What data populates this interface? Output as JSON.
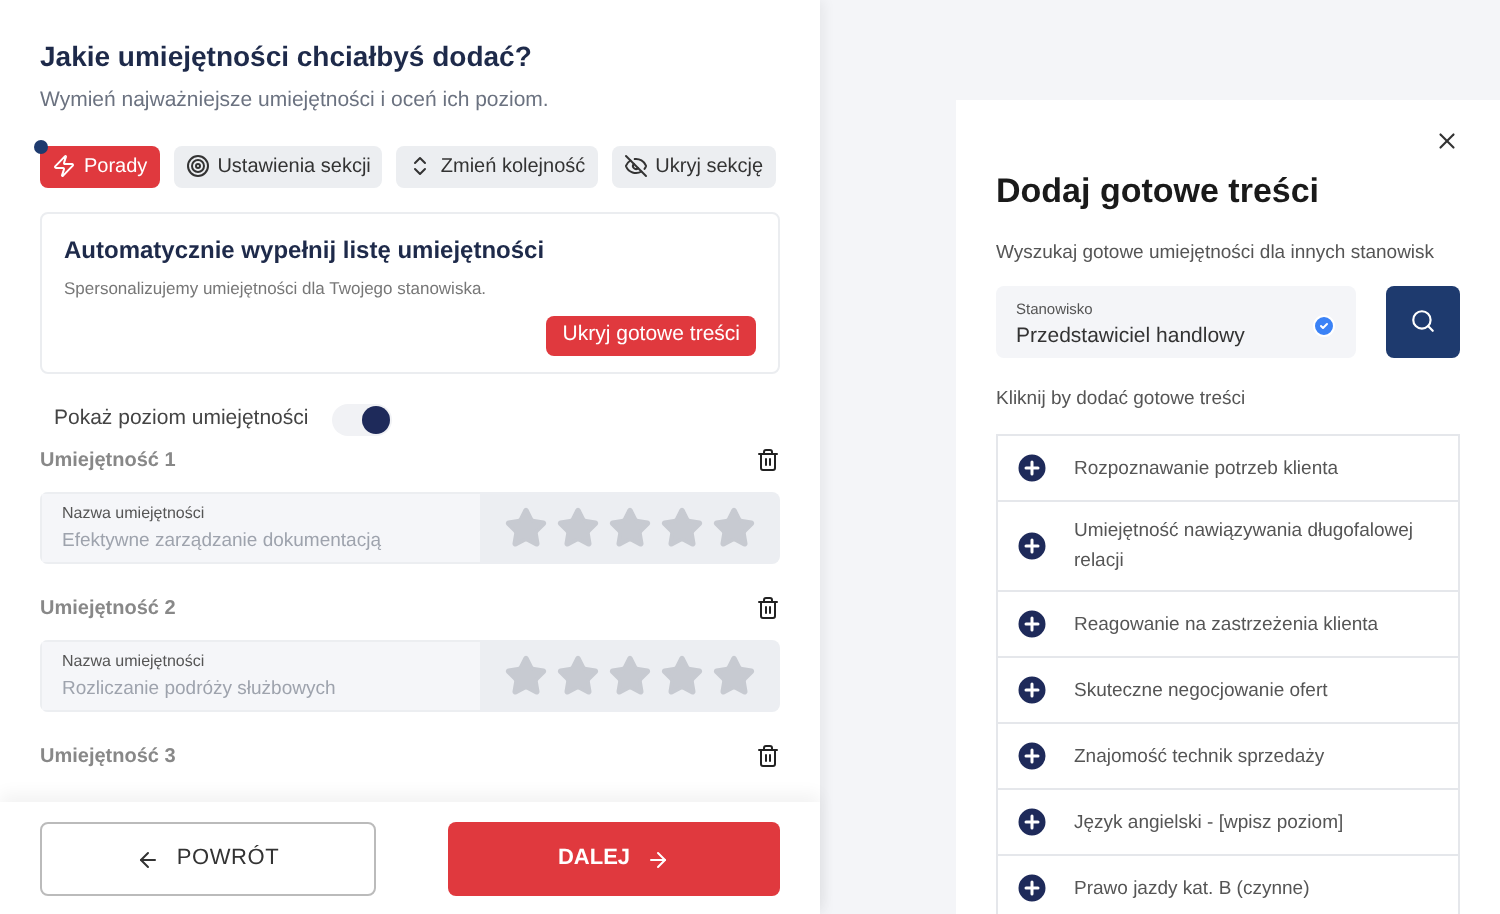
{
  "header": {
    "title": "Jakie umiejętności chciałbyś dodać?",
    "subtitle": "Wymień najważniejsze umiejętności i oceń ich poziom."
  },
  "toolbar": [
    {
      "kind": "tips",
      "label": "Porady",
      "selected": true
    },
    {
      "kind": "settings",
      "label": "Ustawienia sekcji",
      "selected": false
    },
    {
      "kind": "reorder",
      "label": "Zmień kolejność",
      "selected": false
    },
    {
      "kind": "hide",
      "label": "Ukryj sekcję",
      "selected": false
    }
  ],
  "autofill": {
    "title": "Automatycznie wypełnij listę umiejętności",
    "text": "Spersonalizujemy umiejętności dla Twojego stanowiska.",
    "button": "Ukryj gotowe treści"
  },
  "level_toggle": {
    "label": "Pokaż poziom umiejętności",
    "on": true
  },
  "skills": [
    {
      "heading": "Umiejętność 1",
      "field_label": "Nazwa umiejętności",
      "placeholder": "Efektywne zarządzanie dokumentacją",
      "stars": 0
    },
    {
      "heading": "Umiejętność 2",
      "field_label": "Nazwa umiejętności",
      "placeholder": "Rozliczanie podróży służbowych",
      "stars": 0
    },
    {
      "heading": "Umiejętność 3"
    }
  ],
  "footer": {
    "back": "POWRÓT",
    "next": "DALEJ"
  },
  "panel": {
    "title": "Dodaj gotowe treści",
    "subtitle": "Wyszukaj gotowe umiejętności dla innych stanowisk",
    "field_label": "Stanowisko",
    "field_value": "Przedstawiciel handlowy",
    "hint": "Kliknij by dodać gotowe treści",
    "items": [
      "Rozpoznawanie potrzeb klienta",
      "Umiejętność nawiązywania długofalowej relacji",
      "Reagowanie na zastrzeżenia klienta",
      "Skuteczne negocjowanie ofert",
      "Znajomość technik sprzedaży",
      "Język angielski - [wpisz poziom]",
      "Prawo jazdy kat. B (czynne)"
    ]
  }
}
